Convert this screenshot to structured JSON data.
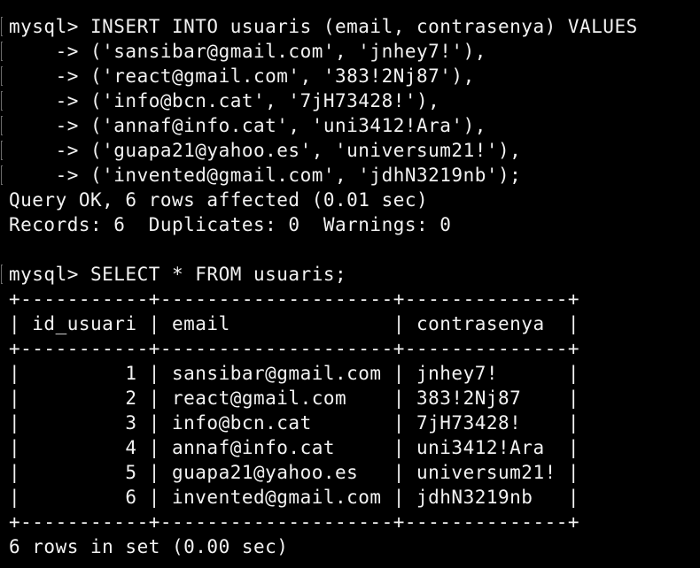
{
  "terminal": {
    "colors": {
      "background": "#000000",
      "foreground": "#f2f2f2",
      "prompt_marker": "#6c6c6c"
    },
    "lines": [
      {
        "text": "mysql> INSERT INTO usuaris (email, contrasenya) VALUES",
        "marker": true
      },
      {
        "text": "    -> ('sansibar@gmail.com', 'jnhey7!'),",
        "marker": true
      },
      {
        "text": "    -> ('react@gmail.com', '383!2Nj87'),",
        "marker": true
      },
      {
        "text": "    -> ('info@bcn.cat', '7jH73428!'),",
        "marker": true
      },
      {
        "text": "    -> ('annaf@info.cat', 'uni3412!Ara'),",
        "marker": true
      },
      {
        "text": "    -> ('guapa21@yahoo.es', 'universum21!'),",
        "marker": true
      },
      {
        "text": "    -> ('invented@gmail.com', 'jdhN3219nb');",
        "marker": true
      },
      {
        "text": "Query OK, 6 rows affected (0.01 sec)",
        "marker": false
      },
      {
        "text": "Records: 6  Duplicates: 0  Warnings: 0",
        "marker": false
      },
      {
        "text": "",
        "marker": false
      },
      {
        "text": "mysql> SELECT * FROM usuaris;",
        "marker": true
      },
      {
        "text": "+-----------+--------------------+--------------+",
        "marker": false
      },
      {
        "text": "| id_usuari | email              | contrasenya  |",
        "marker": false
      },
      {
        "text": "+-----------+--------------------+--------------+",
        "marker": false
      },
      {
        "text": "|         1 | sansibar@gmail.com | jnhey7!      |",
        "marker": false
      },
      {
        "text": "|         2 | react@gmail.com    | 383!2Nj87    |",
        "marker": false
      },
      {
        "text": "|         3 | info@bcn.cat       | 7jH73428!    |",
        "marker": false
      },
      {
        "text": "|         4 | annaf@info.cat     | uni3412!Ara  |",
        "marker": false
      },
      {
        "text": "|         5 | guapa21@yahoo.es   | universum21! |",
        "marker": false
      },
      {
        "text": "|         6 | invented@gmail.com | jdhN3219nb   |",
        "marker": false
      },
      {
        "text": "+-----------+--------------------+--------------+",
        "marker": false
      },
      {
        "text": "6 rows in set (0.00 sec)",
        "marker": false
      }
    ]
  }
}
